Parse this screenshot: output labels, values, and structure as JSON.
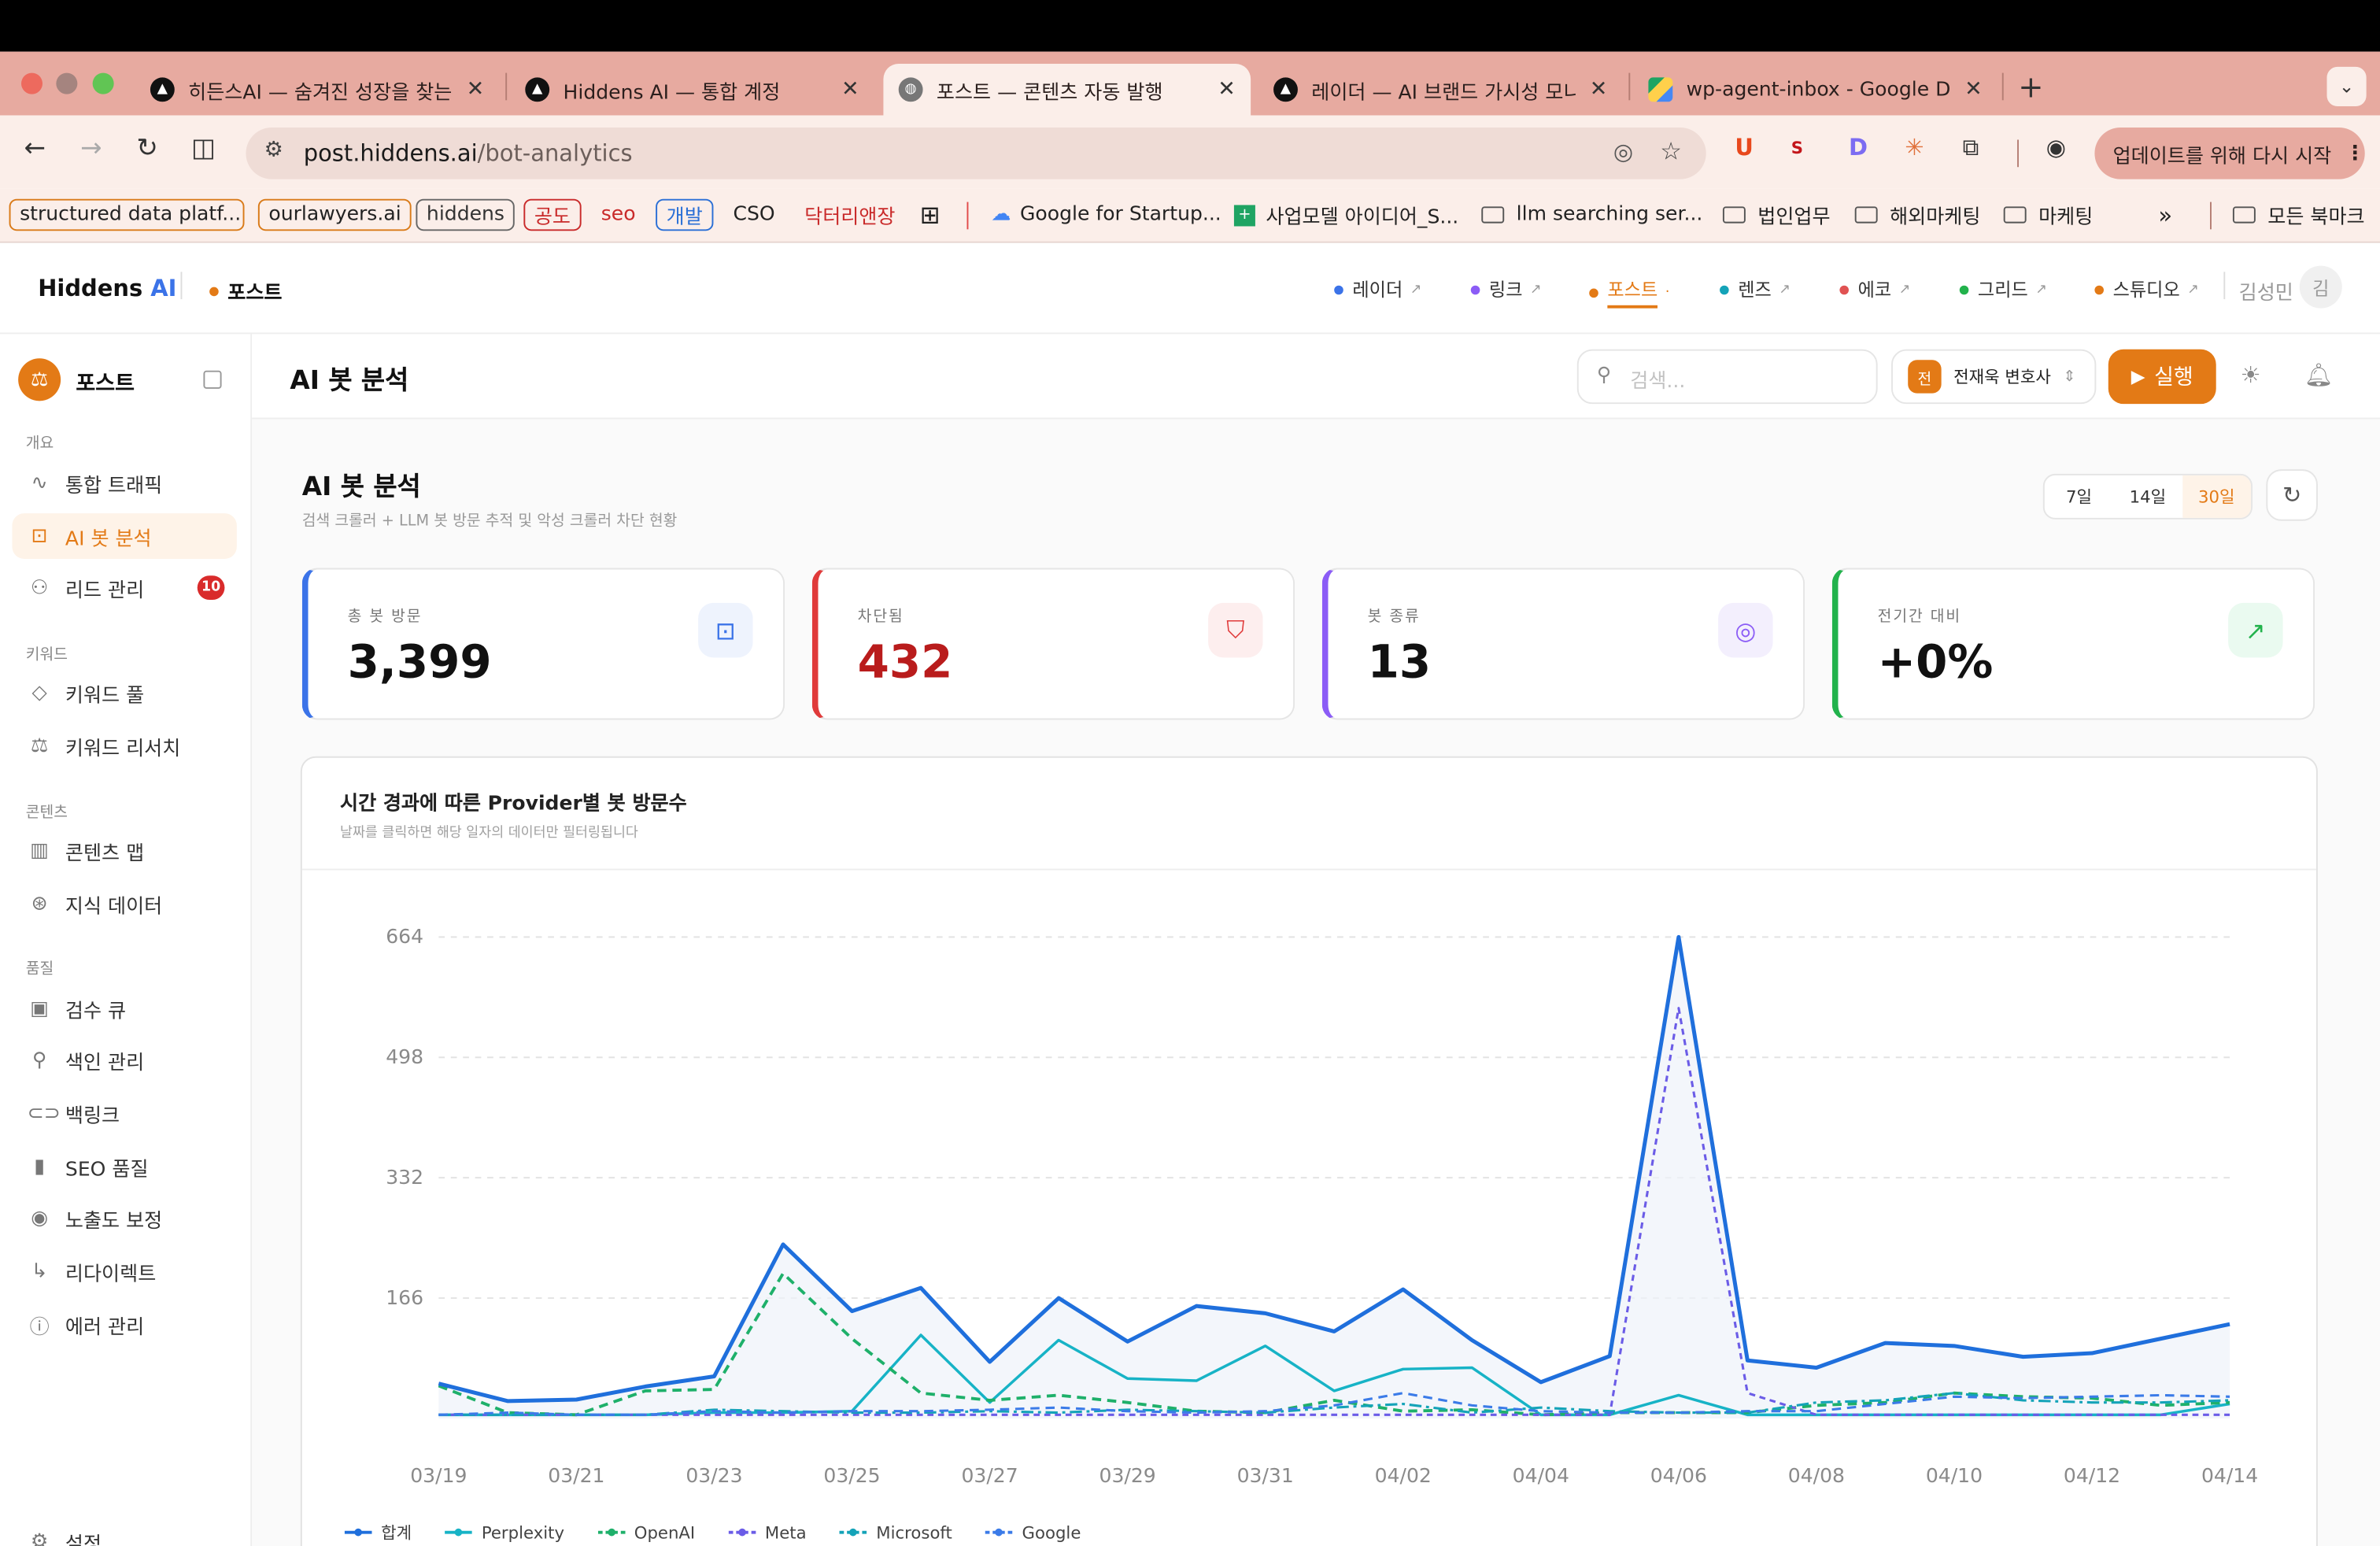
{
  "browser": {
    "tabs": [
      {
        "title": "히든스AI — 숨겨진 성장을 찾는 AI"
      },
      {
        "title": "Hiddens AI — 통합 계정"
      },
      {
        "title": "포스트 — 콘텐츠 자동 발행"
      },
      {
        "title": "레이더 — AI 브랜드 가시성 모니터"
      },
      {
        "title": "wp-agent-inbox - Google Drive"
      }
    ],
    "url_host": "post.hiddens.ai",
    "url_path": "/bot-analytics",
    "update_button": "업데이트를 위해 다시 시작",
    "bookmarks": [
      "structured data platf...",
      "ourlawyers.ai",
      "hiddens",
      "공도",
      "seo",
      "개발",
      "CSO",
      "닥터리앤장",
      "Google for Startup...",
      "사업모델 아이디어_S...",
      "llm searching ser...",
      "법인업무",
      "해외마케팅",
      "마케팅",
      "»",
      "모든 북마크"
    ]
  },
  "app": {
    "brand": "Hiddens",
    "brand_ai": "AI",
    "current_product": "포스트",
    "products": [
      {
        "label": "레이더",
        "color": "#3b73e8"
      },
      {
        "label": "링크",
        "color": "#8b5cf6"
      },
      {
        "label": "포스트",
        "color": "#e37a16"
      },
      {
        "label": "렌즈",
        "color": "#14a3b8"
      },
      {
        "label": "에코",
        "color": "#e05252"
      },
      {
        "label": "그리드",
        "color": "#22b24c"
      },
      {
        "label": "스튜디오",
        "color": "#e37a16"
      }
    ],
    "user_name": "김성민",
    "user_initial": "김"
  },
  "sidebar": {
    "logo": "⚖",
    "title": "포스트",
    "sections": {
      "overview": "개요",
      "keyword": "키워드",
      "content": "콘텐츠",
      "quality": "품질"
    },
    "items": [
      {
        "label": "통합 트래픽",
        "icon": "activity-icon"
      },
      {
        "label": "AI 봇 분석",
        "icon": "bot-icon"
      },
      {
        "label": "리드 관리",
        "icon": "user-icon",
        "badge": "10"
      },
      {
        "label": "키워드 풀",
        "icon": "gem-icon"
      },
      {
        "label": "키워드 리서치",
        "icon": "scale-icon"
      },
      {
        "label": "콘텐츠 맵",
        "icon": "map-icon"
      },
      {
        "label": "지식 데이터",
        "icon": "brain-icon"
      },
      {
        "label": "검수 큐",
        "icon": "clipboard-check-icon"
      },
      {
        "label": "색인 관리",
        "icon": "search-icon"
      },
      {
        "label": "백링크",
        "icon": "link-icon"
      },
      {
        "label": "SEO 품질",
        "icon": "bar-chart-icon"
      },
      {
        "label": "노출도 보정",
        "icon": "eye-icon"
      },
      {
        "label": "리다이렉트",
        "icon": "corner-arrow-icon"
      },
      {
        "label": "에러 관리",
        "icon": "alert-circle-icon"
      },
      {
        "label": "설정",
        "icon": "gear-icon"
      }
    ]
  },
  "header": {
    "page_title": "AI 봇 분석",
    "search_placeholder": "검색...",
    "user_avatar": "전",
    "user_select": "전재욱 변호사",
    "run_label": "실행"
  },
  "section": {
    "title": "AI 봇 분석",
    "subtitle": "검색 크롤러 + LLM 봇 방문 추적 및 악성 크롤러 차단 현황",
    "ranges": [
      "7일",
      "14일",
      "30일"
    ],
    "active_range": "30일"
  },
  "stats": [
    {
      "label": "총 봇 방문",
      "value": "3,399",
      "color": "#3b73e8",
      "value_color": "#111111",
      "icon": "bot-icon"
    },
    {
      "label": "차단됨",
      "value": "432",
      "color": "#e03a3a",
      "value_color": "#b91c1c",
      "icon": "shield-off-icon"
    },
    {
      "label": "봇 종류",
      "value": "13",
      "color": "#8b5cf6",
      "value_color": "#111111",
      "icon": "fingerprint-icon"
    },
    {
      "label": "전기간 대비",
      "value": "+0%",
      "color": "#22b24c",
      "value_color": "#111111",
      "icon": "trending-up-icon"
    }
  ],
  "chart": {
    "title": "시간 경과에 따른 Provider별 봇 방문수",
    "subtitle": "날짜를 클릭하면 해당 일자의 데이터만 필터링됩니다"
  },
  "chart_data": {
    "type": "line",
    "x": [
      "03/19",
      "03/20",
      "03/21",
      "03/22",
      "03/23",
      "03/24",
      "03/25",
      "03/26",
      "03/27",
      "03/28",
      "03/29",
      "03/30",
      "03/31",
      "04/01",
      "04/02",
      "04/03",
      "04/04",
      "04/05",
      "04/06",
      "04/07",
      "04/08",
      "04/09",
      "04/10",
      "04/11",
      "04/12",
      "04/13",
      "04/14"
    ],
    "x_tick_labels": [
      "03/19",
      "03/21",
      "03/23",
      "03/25",
      "03/27",
      "03/29",
      "03/31",
      "04/02",
      "04/04",
      "04/06",
      "04/08",
      "04/10",
      "04/12",
      "04/14"
    ],
    "y_ticks": [
      166,
      332,
      498,
      664
    ],
    "ylim": [
      0,
      664
    ],
    "grid": true,
    "legend": "bottom-left",
    "series": [
      {
        "name": "합계",
        "color": "#1f6fdc",
        "dash": "",
        "width": 2.6,
        "values": [
          48,
          24,
          26,
          44,
          58,
          240,
          148,
          180,
          78,
          166,
          106,
          155,
          145,
          120,
          178,
          108,
          50,
          86,
          664,
          80,
          70,
          104,
          100,
          85,
          90,
          110,
          130
        ]
      },
      {
        "name": "Perplexity",
        "color": "#17b3c6",
        "dash": "",
        "width": 1.8,
        "values": [
          5,
          5,
          5,
          5,
          8,
          8,
          10,
          115,
          22,
          108,
          55,
          52,
          100,
          38,
          68,
          70,
          5,
          5,
          32,
          5,
          5,
          5,
          5,
          5,
          5,
          5,
          20
        ]
      },
      {
        "name": "OpenAI",
        "color": "#1eb06a",
        "dash": "6,4",
        "width": 2,
        "values": [
          45,
          8,
          5,
          38,
          40,
          200,
          110,
          35,
          25,
          32,
          22,
          10,
          8,
          25,
          10,
          12,
          5,
          8,
          8,
          8,
          18,
          22,
          35,
          30,
          28,
          18,
          22
        ]
      },
      {
        "name": "Meta",
        "color": "#6b5ce7",
        "dash": "4,3",
        "width": 1.6,
        "values": [
          5,
          5,
          5,
          5,
          5,
          5,
          5,
          5,
          5,
          5,
          5,
          5,
          5,
          5,
          5,
          5,
          5,
          5,
          566,
          35,
          5,
          5,
          5,
          5,
          5,
          5,
          5
        ]
      },
      {
        "name": "Microsoft",
        "color": "#14a3b8",
        "dash": "8,3,2,3",
        "width": 1.6,
        "values": [
          5,
          5,
          5,
          5,
          12,
          10,
          8,
          8,
          10,
          8,
          12,
          10,
          8,
          15,
          20,
          8,
          15,
          10,
          8,
          8,
          22,
          25,
          35,
          25,
          22,
          22,
          25
        ]
      },
      {
        "name": "Google",
        "color": "#3b7be8",
        "dash": "6,4",
        "width": 1.6,
        "values": [
          5,
          8,
          5,
          5,
          10,
          8,
          10,
          10,
          12,
          15,
          10,
          8,
          10,
          18,
          35,
          18,
          10,
          8,
          8,
          10,
          10,
          20,
          30,
          28,
          30,
          32,
          30
        ]
      }
    ]
  }
}
